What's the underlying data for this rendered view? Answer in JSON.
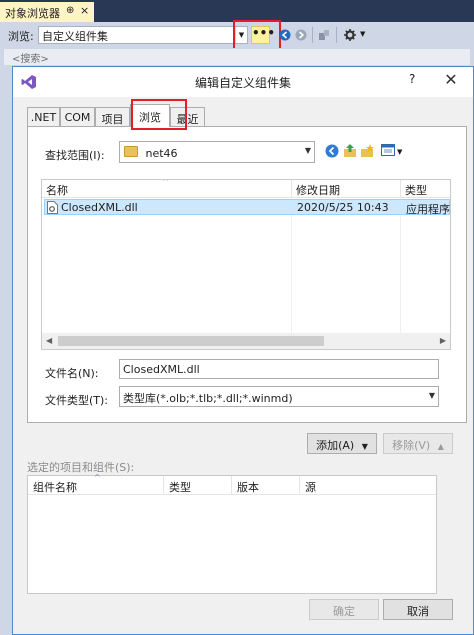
{
  "object_browser": {
    "tab_title": "对象浏览器",
    "tab_pin": "⊕",
    "tab_close": "×",
    "browse_label": "浏览:",
    "browse_value": "自定义组件集",
    "more_button": "•••",
    "search_placeholder": "<搜索>"
  },
  "dialog": {
    "title": "编辑自定义组件集",
    "help": "?",
    "close": "✕",
    "tabs": [
      ".NET",
      "COM",
      "项目",
      "浏览",
      "最近"
    ],
    "active_tab": "浏览",
    "look_in_label": "查找范围(I):",
    "look_in_value": "net46",
    "file_list": {
      "columns": [
        "名称",
        "修改日期",
        "类型"
      ],
      "rows": [
        {
          "name": "ClosedXML.dll",
          "modified": "2020/5/25 10:43",
          "type": "应用程序"
        }
      ]
    },
    "file_name_label": "文件名(N):",
    "file_name_value": "ClosedXML.dll",
    "file_type_label": "文件类型(T):",
    "file_type_value": "类型库(*.olb;*.tlb;*.dll;*.winmd)",
    "add_button": "添加(A)",
    "remove_button": "移除(V)",
    "selected_label": "选定的项目和组件(S):",
    "selected_columns": [
      "组件名称",
      "类型",
      "版本",
      "源"
    ],
    "ok_button": "确定",
    "cancel_button": "取消"
  },
  "colors": {
    "highlight": "#e21f26",
    "selection": "#cce8ff",
    "vs_dark": "#293955"
  }
}
